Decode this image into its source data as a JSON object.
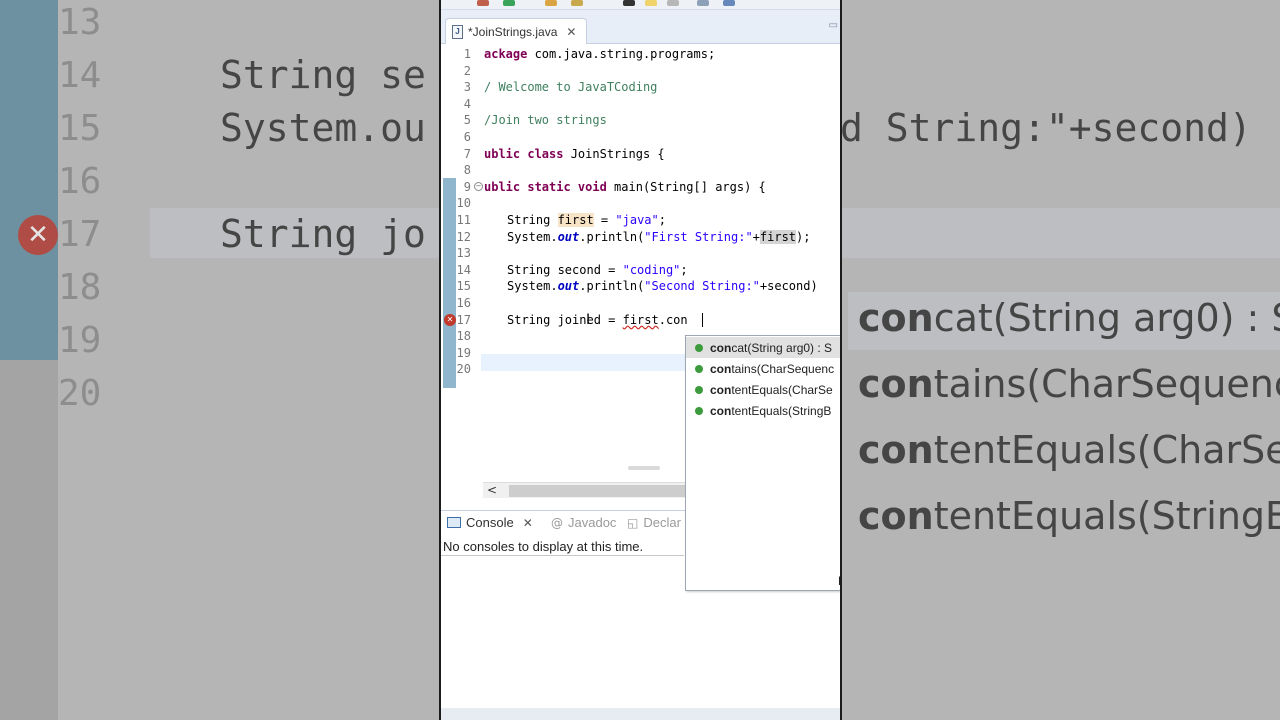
{
  "background": {
    "line_numbers": [
      "13",
      "14",
      "15",
      "16",
      "17",
      "18",
      "19",
      "20"
    ],
    "code_fragments": [
      "String se",
      "System.ou",
      "String jo"
    ],
    "right_fragment": "d String:\"+second)",
    "suggestions": [
      {
        "match": "con",
        "rest": "cat(String arg0) : S"
      },
      {
        "match": "con",
        "rest": "tains(CharSequenc"
      },
      {
        "match": "con",
        "rest": "tentEquals(CharSe"
      },
      {
        "match": "con",
        "rest": "tentEquals(StringB"
      }
    ]
  },
  "editor": {
    "tab": {
      "label": "*JoinStrings.java",
      "icon_text": "J"
    },
    "lines": [
      {
        "n": "1"
      },
      {
        "n": "2"
      },
      {
        "n": "3"
      },
      {
        "n": "4"
      },
      {
        "n": "5"
      },
      {
        "n": "6"
      },
      {
        "n": "7"
      },
      {
        "n": "8"
      },
      {
        "n": "9"
      },
      {
        "n": "10"
      },
      {
        "n": "11"
      },
      {
        "n": "12"
      },
      {
        "n": "13"
      },
      {
        "n": "14"
      },
      {
        "n": "15"
      },
      {
        "n": "16"
      },
      {
        "n": "17"
      },
      {
        "n": "18"
      },
      {
        "n": "19"
      },
      {
        "n": "20"
      }
    ],
    "code": {
      "l1_kw": "ackage",
      "l1_rest": " com.java.string.programs;",
      "l3": "/ Welcome to JavaTCoding",
      "l5": "/Join two strings",
      "l7_kw": "ublic class",
      "l7_rest": " JoinStrings {",
      "l9_kw": "ublic static void",
      "l9_rest": " main(String[] args) {",
      "l11_a": "String ",
      "l11_var": "first",
      "l11_b": " = ",
      "l11_str": "\"java\"",
      "l11_c": ";",
      "l12_a": "System.",
      "l12_out": "out",
      "l12_b": ".println(",
      "l12_str": "\"First String:\"",
      "l12_c": "+",
      "l12_var": "first",
      "l12_d": ");",
      "l14_a": "String second = ",
      "l14_str": "\"coding\"",
      "l14_c": ";",
      "l15_a": "System.",
      "l15_out": "out",
      "l15_b": ".println(",
      "l15_str": "\"Second String:\"",
      "l15_c": "+second)",
      "l17_a": "String joined = ",
      "l17_var": "first",
      "l17_b": ".con"
    }
  },
  "completion": {
    "items": [
      {
        "match": "con",
        "rest": "cat(String arg0) : S"
      },
      {
        "match": "con",
        "rest": "tains(CharSequenc"
      },
      {
        "match": "con",
        "rest": "tentEquals(CharSe"
      },
      {
        "match": "con",
        "rest": "tentEquals(StringB"
      }
    ],
    "corner": "P"
  },
  "console": {
    "tabs": [
      "Console",
      "Javadoc",
      "Declar"
    ],
    "message": "No consoles to display at this time."
  },
  "colors": {
    "keyword": "#7f0055",
    "string": "#2a00ff",
    "comment": "#3f7f5f",
    "field": "#0000c0",
    "error": "#c0392b"
  }
}
